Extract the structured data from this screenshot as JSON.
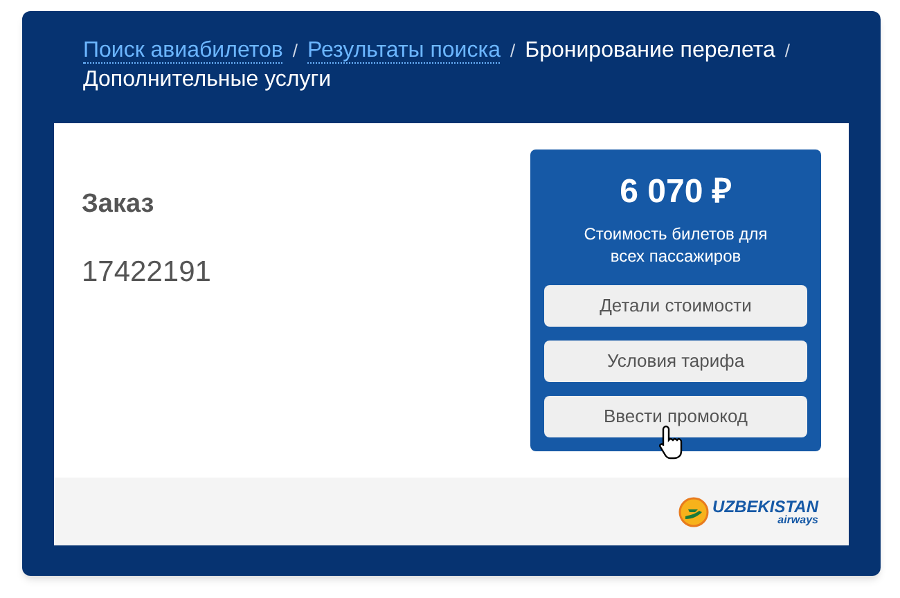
{
  "breadcrumbs": [
    {
      "label": "Поиск авиабилетов",
      "kind": "link"
    },
    {
      "label": "Результаты поиска",
      "kind": "link"
    },
    {
      "label": "Бронирование перелета",
      "kind": "text"
    },
    {
      "label": "Дополнительные услуги",
      "kind": "text"
    }
  ],
  "separator": "/",
  "order": {
    "label": "Заказ",
    "number": "17422191"
  },
  "price_box": {
    "price": "6 070 ₽",
    "caption": "Стоимость билетов для всех пассажиров",
    "buttons": [
      "Детали стоимости",
      "Условия тарифа",
      "Ввести промокод"
    ]
  },
  "logo": {
    "name": "UZBEKISTAN",
    "subtitle": "airways"
  }
}
